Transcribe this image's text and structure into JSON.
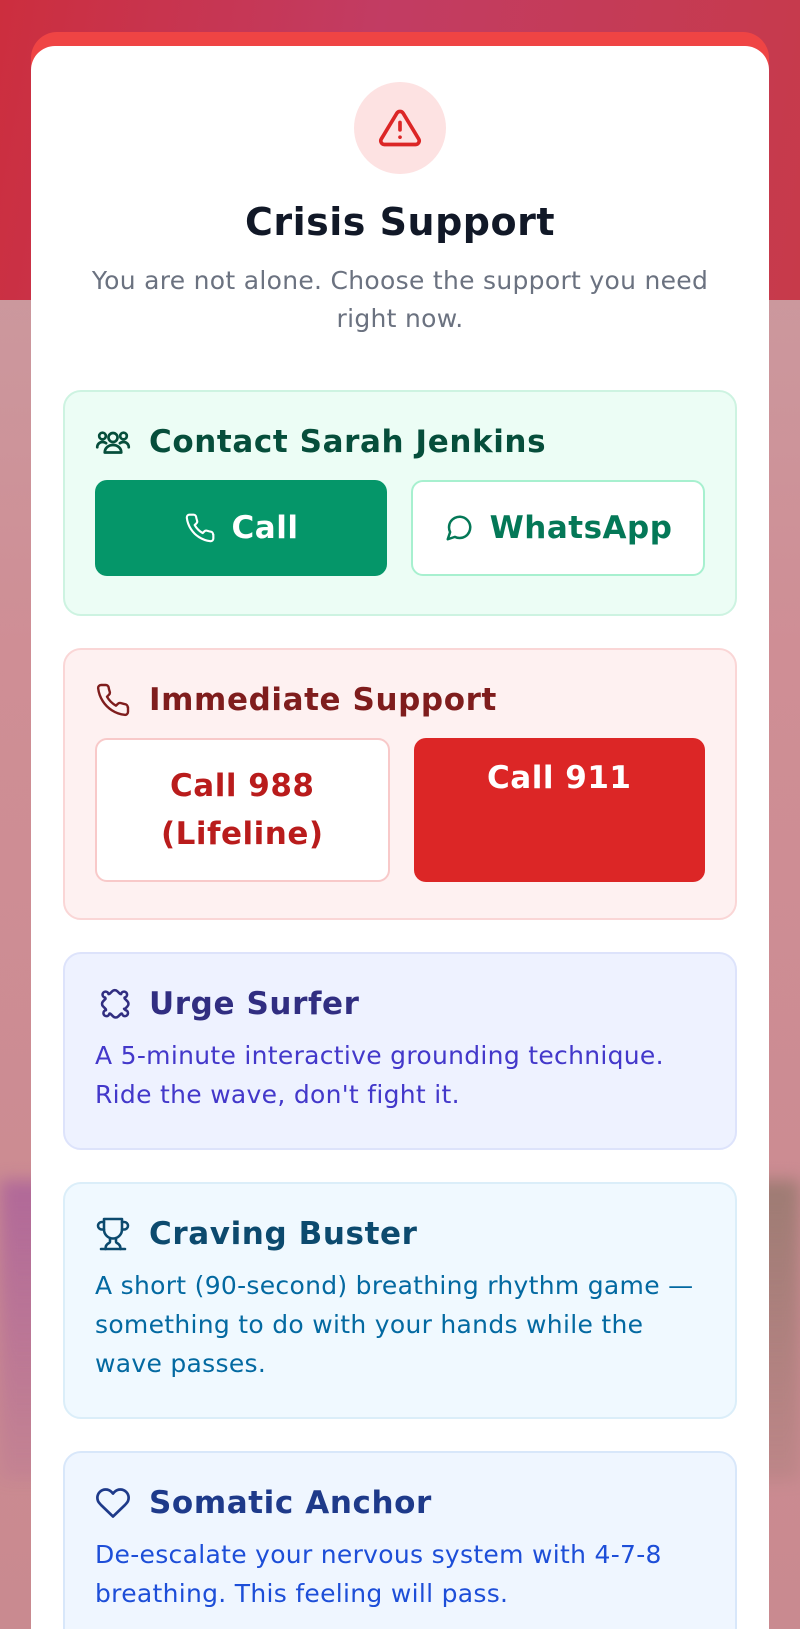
{
  "header": {
    "title": "Crisis Support",
    "subtitle": "You are not alone. Choose the support you need right now."
  },
  "contact": {
    "title": "Contact Sarah Jenkins",
    "call_label": "Call",
    "whatsapp_label": "WhatsApp"
  },
  "immediate": {
    "title": "Immediate Support",
    "lifeline_line1": "Call 988",
    "lifeline_line2": "(Lifeline)",
    "emergency_label": "Call 911"
  },
  "tools": [
    {
      "title": "Urge Surfer",
      "description": "A 5-minute interactive grounding technique. Ride the wave, don't fight it."
    },
    {
      "title": "Craving Buster",
      "description": "A short (90-second) breathing rhythm game — something to do with your hands while the wave passes."
    },
    {
      "title": "Somatic Anchor",
      "description": "De-escalate your nervous system with 4-7-8 breathing. This feeling will pass."
    }
  ],
  "icons": {
    "alert": "alert-triangle-icon",
    "contact": "users-icon",
    "call": "phone-icon",
    "whatsapp": "message-circle-icon",
    "immediate": "phone-icon",
    "urge": "puzzle-icon",
    "craving": "trophy-icon",
    "somatic": "heart-icon"
  },
  "colors": {
    "accent_red": "#ef4444",
    "green": "#059669",
    "emergency_red": "#dc2626"
  }
}
